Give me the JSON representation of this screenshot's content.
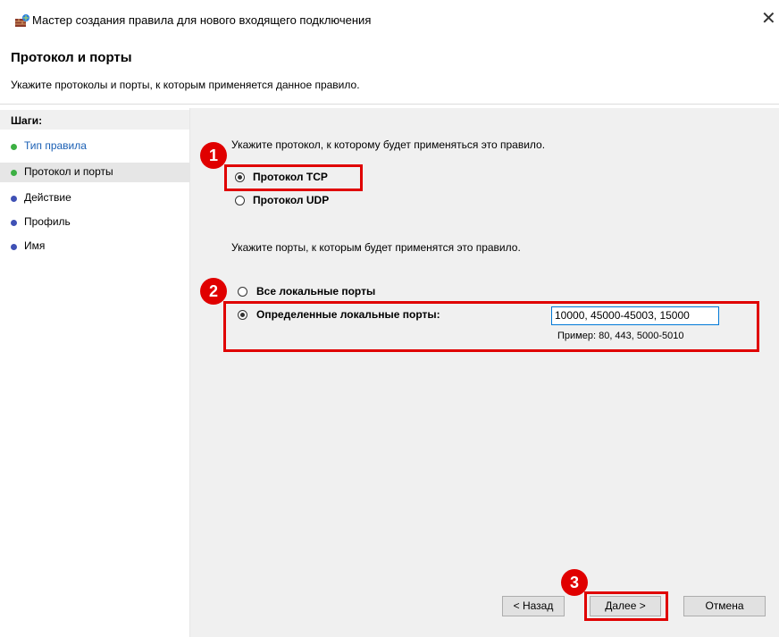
{
  "window": {
    "title": "Мастер создания правила для нового входящего подключения"
  },
  "header": {
    "title": "Протокол и порты",
    "subtitle": "Укажите протоколы и порты, к которым применяется данное правило."
  },
  "steps": {
    "heading": "Шаги:",
    "items": [
      {
        "label": "Тип правила",
        "dot_color": "#3cb043",
        "link_color": "#1a5fb4"
      },
      {
        "label": "Протокол и порты",
        "dot_color": "#3cb043"
      },
      {
        "label": "Действие",
        "dot_color": "#3f51b5"
      },
      {
        "label": "Профиль",
        "dot_color": "#3f51b5"
      },
      {
        "label": "Имя",
        "dot_color": "#3f51b5"
      }
    ]
  },
  "protocol": {
    "prompt": "Укажите протокол, к которому будет применяться это правило.",
    "tcp_label": "Протокол TCP",
    "udp_label": "Протокол UDP",
    "selected": "tcp"
  },
  "ports": {
    "prompt": "Укажите порты, к которым будет применятся это правило.",
    "all_label": "Все локальные порты",
    "specific_label": "Определенные локальные порты:",
    "value": "10000, 45000-45003, 15000",
    "example": "Пример: 80, 443, 5000-5010",
    "selected": "specific"
  },
  "annotations": {
    "badge1": "1",
    "badge2": "2",
    "badge3": "3",
    "color": "#e00000"
  },
  "buttons": {
    "back": "< Назад",
    "next": "Далее >",
    "cancel": "Отмена"
  }
}
